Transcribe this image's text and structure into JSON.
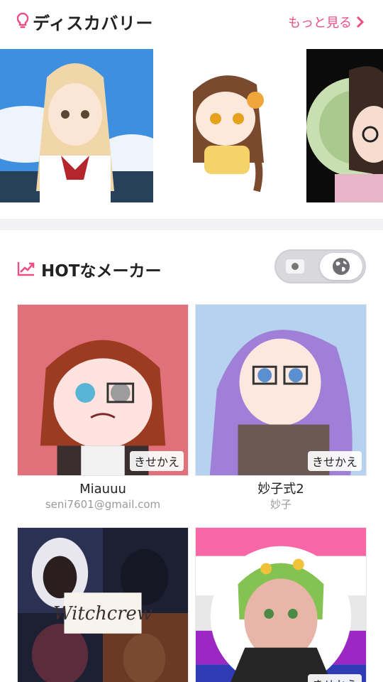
{
  "discovery": {
    "title": "ディスカバリー",
    "more_label": "もっと見る",
    "cards": [
      {
        "name": "discovery-card-1"
      },
      {
        "name": "discovery-card-2"
      },
      {
        "name": "discovery-card-3"
      }
    ]
  },
  "hot": {
    "title": "HOTなメーカー",
    "toggle": {
      "left_icon": "record-dot-icon",
      "right_icon": "globe-icon",
      "selected": "globe"
    }
  },
  "makers": [
    {
      "name": "Miauuu",
      "author": "seni7601@gmail.com",
      "badge": "きせかえ"
    },
    {
      "name": "妙子式2",
      "author": "妙子",
      "badge": "きせかえ"
    },
    {
      "name": "",
      "author": "",
      "badge": "",
      "image_text": "Witchcrew"
    },
    {
      "name": "",
      "author": "",
      "badge": "きせかえ"
    }
  ],
  "colors": {
    "accent": "#ee4f82",
    "band": "#f2f2f4"
  }
}
